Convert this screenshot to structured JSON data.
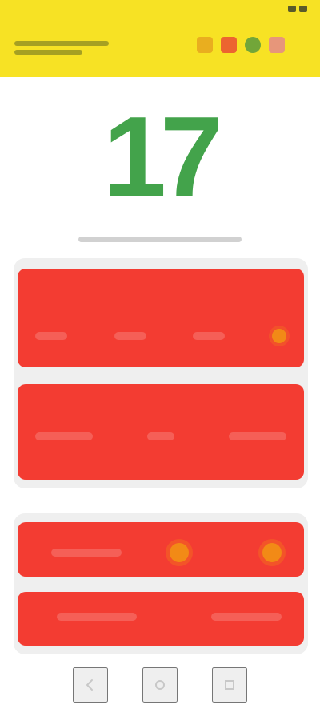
{
  "app": {
    "title": "",
    "status_time": "",
    "score": "17"
  },
  "cards": {
    "card_a_title": "",
    "card_b_title": "",
    "card_c_label": "",
    "card_d_label": ""
  },
  "icons": {
    "status_wifi": "wifi-icon",
    "status_battery": "battery-icon",
    "app_icon_1": "sun-icon",
    "app_icon_2": "fire-icon",
    "app_icon_3": "globe-icon",
    "app_icon_4": "heart-icon",
    "nav_back": "back-icon",
    "nav_home": "home-icon",
    "nav_recent": "recent-apps-icon"
  },
  "colors": {
    "header": "#f7e224",
    "score": "#43a34b",
    "card": "#f33c32",
    "badge": "#f28a16"
  }
}
